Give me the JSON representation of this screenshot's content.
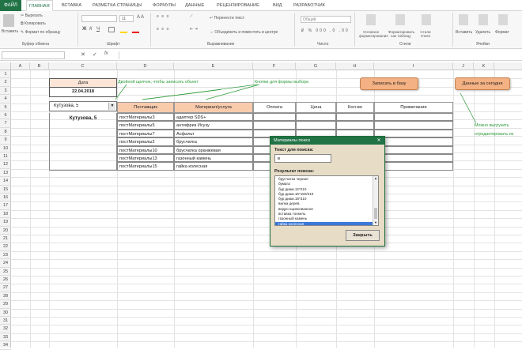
{
  "ribbon": {
    "file_tab": "ФАЙЛ",
    "tabs": [
      "ГЛАВНАЯ",
      "ВСТАВКА",
      "РАЗМЕТКА СТРАНИЦЫ",
      "ФОРМУЛЫ",
      "ДАННЫЕ",
      "РЕЦЕНЗИРОВАНИЕ",
      "ВИД",
      "РАЗРАБОТЧИК"
    ],
    "clipboard": {
      "paste": "Вставить",
      "cut": "Вырезать",
      "copy": "Копировать",
      "format_painter": "Формат по образцу",
      "label": "Буфер обмена"
    },
    "font_label": "Шрифт",
    "font_size": "11",
    "alignment": {
      "wrap": "Перенести текст",
      "merge": "Объединить и поместить в центре",
      "label": "Выравнивание"
    },
    "number": {
      "format": "Общий",
      "label": "Число"
    },
    "styles": {
      "conditional": "Условное форматирование",
      "as_table": "Форматировать как таблицу",
      "cell_styles": "Стили ячеек",
      "label": "Стили"
    },
    "cells": {
      "insert": "Вставить",
      "delete": "Удалить",
      "format": "Формат",
      "label": "Ячейки"
    }
  },
  "formula_bar": {
    "name_box": "",
    "fx": "fx",
    "value": ""
  },
  "columns": [
    "A",
    "B",
    "C",
    "D",
    "E",
    "F",
    "G",
    "H",
    "I",
    "J",
    "K"
  ],
  "rows": [
    "1",
    "2",
    "3",
    "4",
    "5",
    "6",
    "7",
    "8",
    "9",
    "10",
    "11",
    "12",
    "13",
    "14",
    "15",
    "16",
    "17",
    "18",
    "19",
    "20",
    "21",
    "22",
    "23",
    "24",
    "25",
    "26",
    "27",
    "28",
    "29",
    "30",
    "31",
    "32",
    "33",
    "34"
  ],
  "sheet": {
    "date_label": "Дата",
    "date_value": "22.04.2018",
    "note_dblclick": "Двойной щелчок, чтобы записать объект",
    "note_buttons": "Кнопки для формы выбора",
    "btn_save": "Записать в базу",
    "btn_today": "Данные за сегодня",
    "note_right": [
      "Можно выгрузить",
      "отредактировать из"
    ],
    "address_combo": "Кутузова, 5",
    "address_bold": "Кутузова, 5",
    "headers": [
      "Поставщик",
      "Материал/услуга",
      "Оплата",
      "Цена",
      "Кол-во",
      "Примечание"
    ],
    "rows": [
      [
        "постМатериалы3",
        "адаптер SDS+"
      ],
      [
        "постМатериалы5",
        "антифриз Исузу"
      ],
      [
        "постМатериалы7",
        "Асфальт"
      ],
      [
        "постМатериалы2",
        "брусчатка"
      ],
      [
        "постМатериалы10",
        "брусчатка оранжевая"
      ],
      [
        "постМатериалы13",
        "газонный камень"
      ],
      [
        "постМатериалы15",
        "гайка колесная"
      ]
    ]
  },
  "dialog": {
    "title": "Материалы поиск",
    "search_label": "Текст для поиска:",
    "search_value": "в",
    "result_label": "Результат поиска:",
    "items": [
      "брусчатка черная",
      "бумага",
      "бур.диам.12*210",
      "бур.диам.16*150/310",
      "бур.диам.18*310",
      "вилка дерев.",
      "ведро оцинкованное",
      "вставка тонкель",
      "газонный камень",
      "гайка колесная"
    ],
    "selected_index": 9,
    "close_label": "Закрыть"
  },
  "colors": {
    "accent": "#217346",
    "header_fill": "#f8cbad",
    "button_fill": "#f4b183",
    "note_green": "#2e9b3a",
    "selection": "#3c78d8"
  }
}
